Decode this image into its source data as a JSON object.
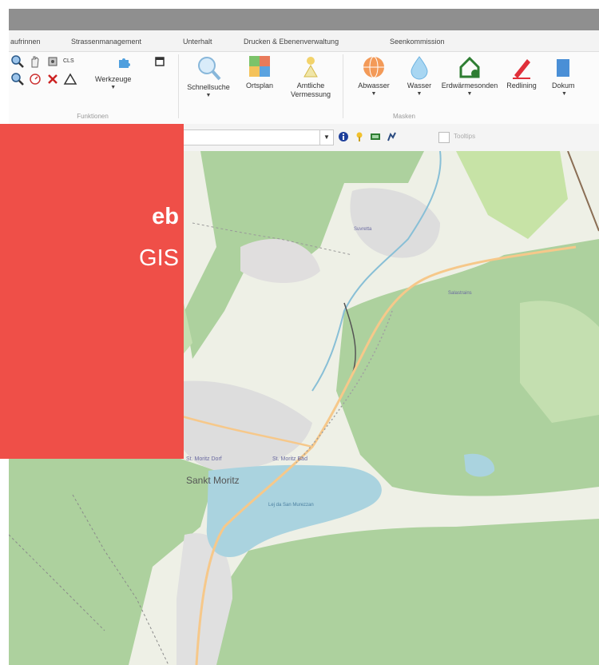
{
  "ribbon": {
    "tabs": [
      "aufrinnen",
      "Strassenmanagement",
      "Unterhalt",
      "Drucken & Ebenenverwaltung",
      "Seenkommission"
    ],
    "groups": {
      "funktionen": {
        "label": "Funktionen",
        "werkzeuge": "Werkzeuge",
        "cls": "CLS"
      },
      "suche": {
        "schnellsuche": "Schnellsuche",
        "ortsplan": "Ortsplan",
        "amtliche": "Amtliche",
        "vermessung": "Vermessung"
      },
      "masken": {
        "label": "Masken",
        "abwasser": "Abwasser",
        "wasser": "Wasser",
        "erdwaerme": "Erdwärmesonden",
        "redlining": "Redlining",
        "dokum": "Dokum"
      }
    }
  },
  "toolbar": {
    "search_value": "",
    "checkbox_label": "Tooltips"
  },
  "map": {
    "main_place": "Sankt Moritz",
    "small_labels": [
      "St. Moritz Dorf",
      "St. Moritz Bad",
      "Lej da San Murezzan",
      "Salastrains",
      "Suvretta"
    ]
  },
  "banner": {
    "line1_visible": "eb",
    "line2_visible": "GIS"
  },
  "colors": {
    "banner": "#ef4f48",
    "forest": "#add19e",
    "lake": "#aad3df",
    "urban": "#dddddd",
    "road_major": "#f6c88a"
  }
}
